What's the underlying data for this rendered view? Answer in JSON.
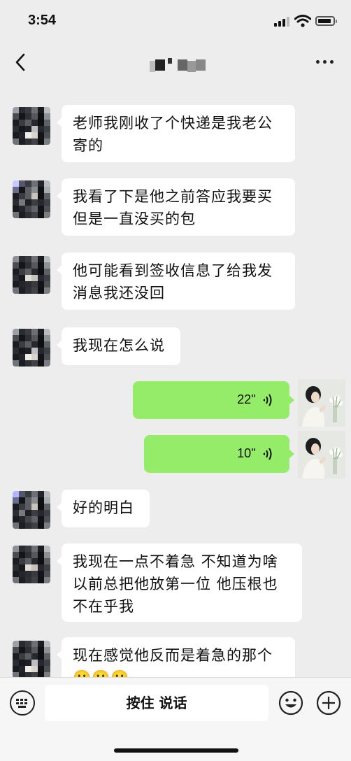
{
  "status_bar": {
    "time": "3:54"
  },
  "nav": {
    "title": "contact-name-pixelated"
  },
  "messages": [
    {
      "side": "in",
      "type": "text",
      "lines": [
        "老师我刚收了个快递是我老公",
        "寄的"
      ]
    },
    {
      "side": "in",
      "type": "text",
      "lines": [
        "我看了下是他之前答应我要买",
        "但是一直没买的包"
      ]
    },
    {
      "side": "in",
      "type": "text",
      "lines": [
        "他可能看到签收信息了给我发",
        "消息我还没回"
      ]
    },
    {
      "side": "in",
      "type": "text",
      "lines": [
        "我现在怎么说"
      ]
    },
    {
      "side": "out",
      "type": "voice",
      "duration": "22''"
    },
    {
      "side": "out",
      "type": "voice",
      "duration": "10''"
    },
    {
      "side": "in",
      "type": "text",
      "lines": [
        "好的明白"
      ]
    },
    {
      "side": "in",
      "type": "text",
      "lines": [
        "我现在一点不着急 不知道为啥",
        "以前总把他放第一位 他压根也",
        "不在乎我"
      ]
    },
    {
      "side": "in",
      "type": "text",
      "lines": [
        "现在感觉他反而是着急的那个",
        "😬😬😬"
      ]
    }
  ],
  "input_bar": {
    "hold_to_talk": "按住 说话"
  }
}
